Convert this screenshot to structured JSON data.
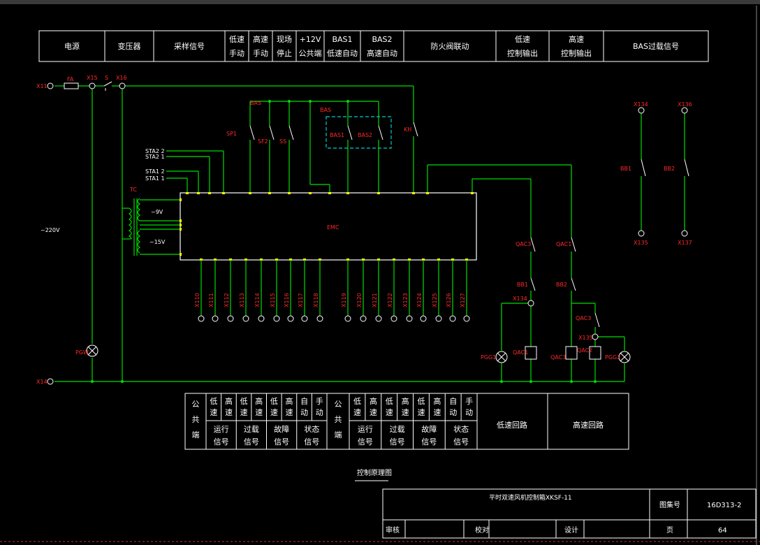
{
  "colors": {
    "background": "#000000",
    "wire": "#00dd00",
    "label": "#ff2a2a",
    "frame": "#ffffff",
    "bas_box": "#00cccc",
    "terminal": "#ffff00"
  },
  "top_header": [
    {
      "lines": [
        "电源"
      ]
    },
    {
      "lines": [
        "变压器"
      ]
    },
    {
      "lines": [
        "采样信号"
      ]
    },
    {
      "lines": [
        "低速",
        "手动"
      ]
    },
    {
      "lines": [
        "高速",
        "手动"
      ]
    },
    {
      "lines": [
        "现场",
        "停止"
      ]
    },
    {
      "lines": [
        "+12V",
        "公共端"
      ]
    },
    {
      "lines": [
        "BAS1",
        "低速自动"
      ]
    },
    {
      "lines": [
        "BAS2",
        "高速自动"
      ]
    },
    {
      "lines": [
        "防火阀联动"
      ]
    },
    {
      "lines": [
        "低速",
        "控制输出"
      ]
    },
    {
      "lines": [
        "高速",
        "控制输出"
      ]
    },
    {
      "lines": [
        "BAS过载信号"
      ]
    }
  ],
  "labels": {
    "x11": "X11",
    "fa": "FA",
    "x15": "X15",
    "s": "S",
    "x16": "X16",
    "x14": "X14",
    "v220": "~220V",
    "tc": "TC",
    "v9": "~9V",
    "v15": "~15V",
    "sta22": "STA2 2",
    "sta21": "STA2 1",
    "sta12": "STA1 2",
    "sta11": "STA1 1",
    "sp1": "SP1",
    "sf2": "SF2",
    "ss": "SS",
    "bas": "BAS",
    "bas1": "BAS1",
    "bas2": "BAS2",
    "kh": "KH",
    "emc": "EMC",
    "qac3": "QAC3",
    "qac1": "QAC1",
    "bb1": "BB1",
    "bb2": "BB2",
    "x134": "X134",
    "x135": "X135",
    "x136": "X136",
    "x137": "X137",
    "qac3b": "QAC3",
    "x135b": "X135",
    "pg0": "PGW",
    "pgg1": "PGG1",
    "qac1c": "QAC1",
    "qac3c": "QAC3",
    "qac2c": "QAC2",
    "pgg2": "PGG2",
    "bb1r": "BB1",
    "bb2r": "BB2",
    "x134r": "X134",
    "x136r": "X136"
  },
  "bottom_terminals": [
    "X110",
    "X111",
    "X112",
    "X113",
    "X114",
    "X115",
    "X116",
    "X117",
    "X118",
    "X119",
    "X120",
    "X121",
    "X122",
    "X123",
    "X124",
    "X125",
    "X126",
    "X127"
  ],
  "lower_table": {
    "left_common": "公共端",
    "left_top": [
      "低速",
      "高速",
      "低速",
      "高速",
      "低速",
      "高速",
      "自动",
      "手动"
    ],
    "left_bottom": [
      "运行信号",
      "过载信号",
      "故障信号",
      "状态信号"
    ],
    "right_common": "公共端",
    "right_top": [
      "低速",
      "高速",
      "低速",
      "高速",
      "低速",
      "高速",
      "自动",
      "手动"
    ],
    "right_bottom": [
      "运行信号",
      "过载信号",
      "故障信号",
      "状态信号"
    ],
    "low_loop": "低速回路",
    "high_loop": "高速回路"
  },
  "caption": "控制原理图",
  "title_block": {
    "title": "平时双速风机控制箱XKSF-11",
    "atlas_label": "图集号",
    "atlas_no": "16D313-2",
    "review": "审核",
    "check": "校对",
    "design": "设计",
    "page_label": "页",
    "page_no": "64"
  }
}
